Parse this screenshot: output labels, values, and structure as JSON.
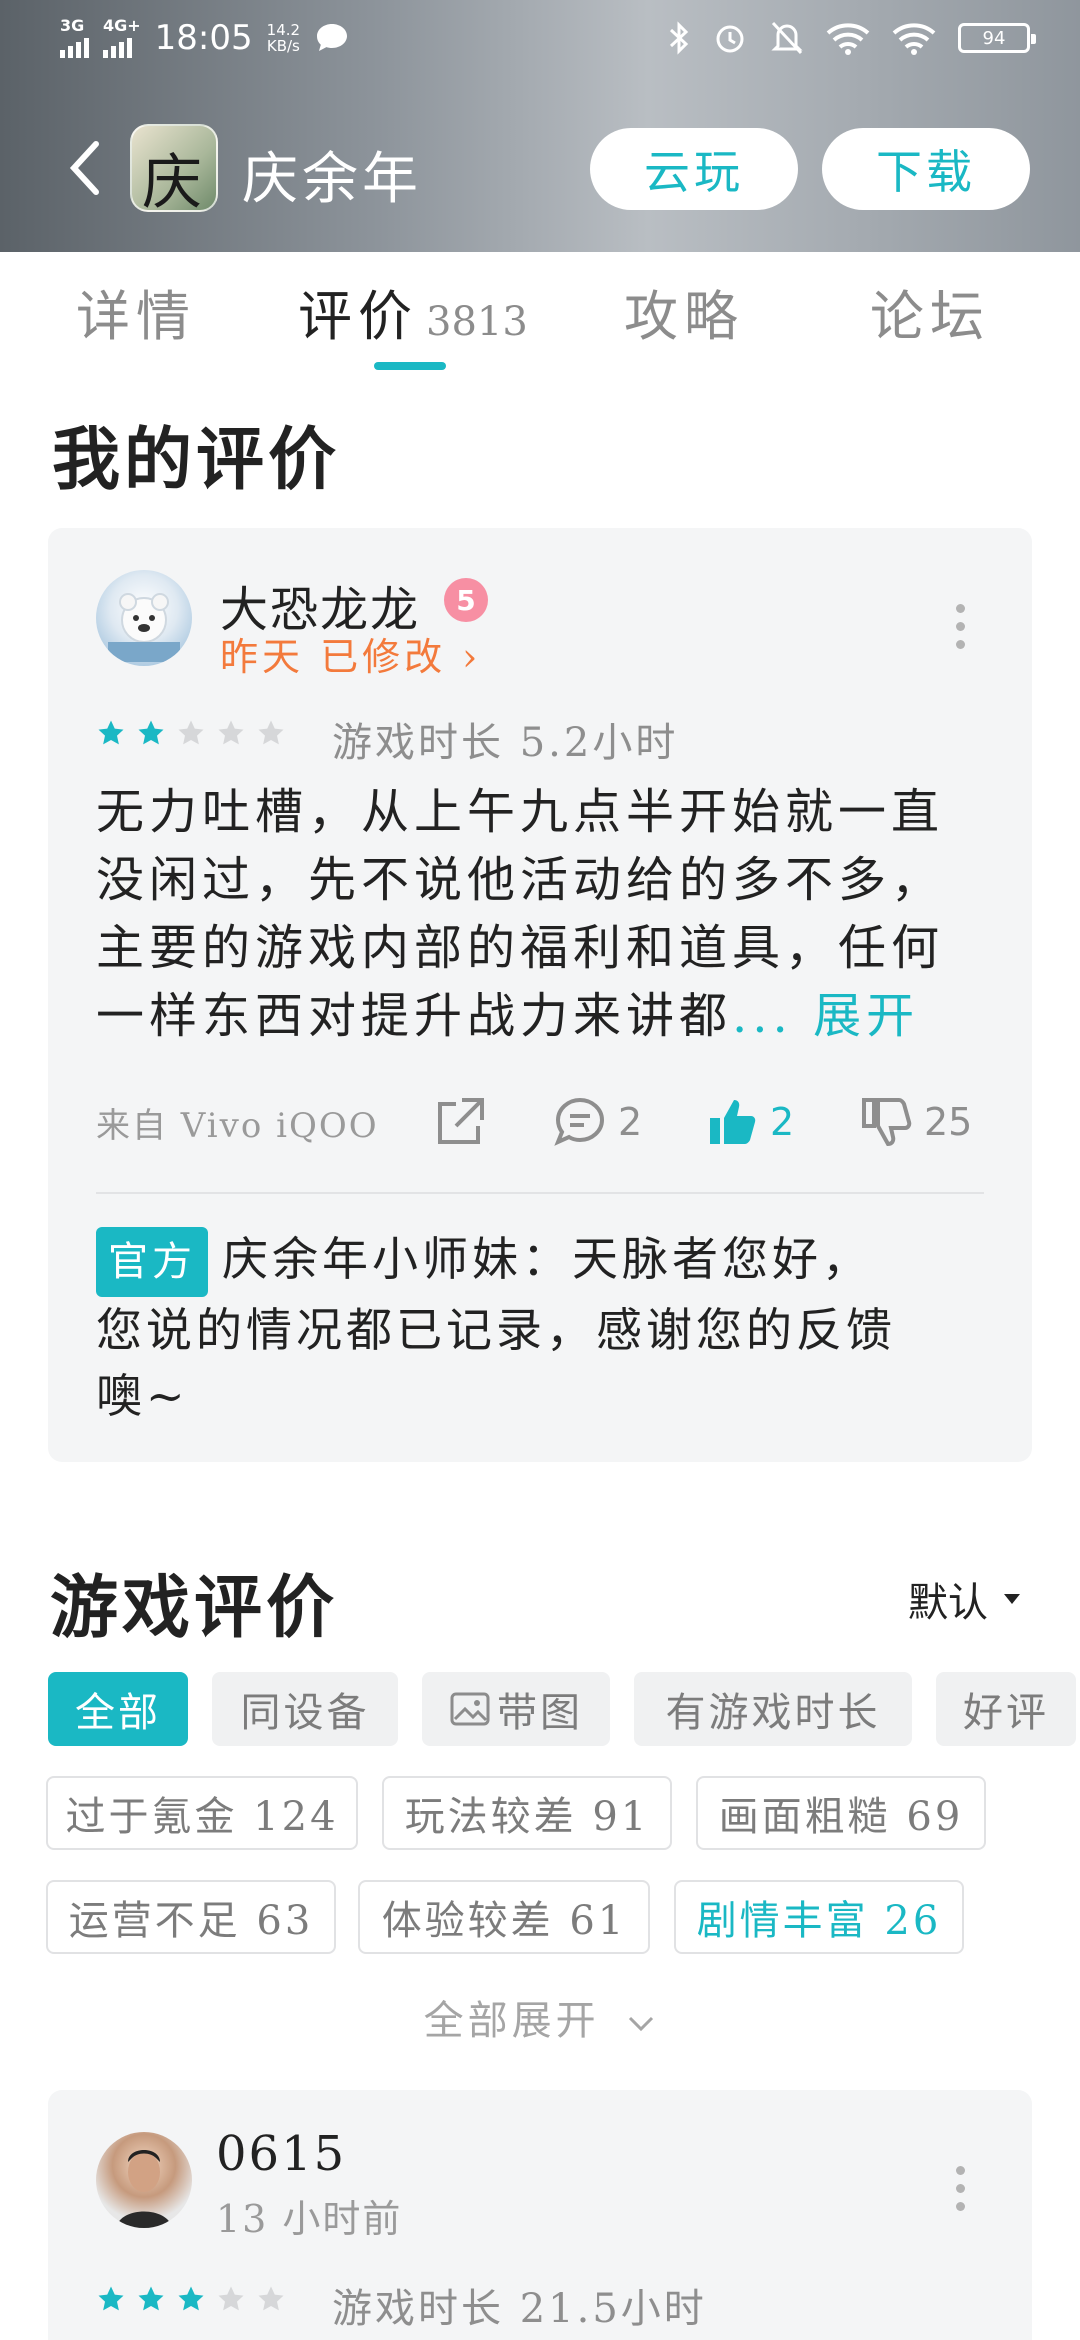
{
  "status_bar": {
    "network1": "3G",
    "network2": "4G+",
    "time": "18:05",
    "speed_value": "14.2",
    "speed_unit": "KB/s",
    "battery": "94"
  },
  "nav": {
    "app_title": "庆余年",
    "icon_glyph": "庆",
    "cloud_play_label": "云玩",
    "download_label": "下载"
  },
  "tabs": [
    {
      "label": "详情"
    },
    {
      "label": "评价",
      "count": "3813"
    },
    {
      "label": "攻略"
    },
    {
      "label": "论坛"
    }
  ],
  "my_review": {
    "section_title": "我的评价",
    "username": "大恐龙龙",
    "level": "5",
    "time_label": "昨天 已修改",
    "stars_filled": 2,
    "stars_total": 5,
    "playtime": "游戏时长 5.2小时",
    "text_lines": [
      "无力吐槽，从上午九点半开始就一直",
      "没闲过，先不说他活动给的多不多，",
      "主要的游戏内部的福利和道具，任何",
      "一样东西对提升战力来讲都"
    ],
    "ellipsis": "...",
    "expand_label": "展开",
    "device": "来自 Vivo iQOO",
    "comments": "2",
    "likes": "2",
    "dislikes": "25",
    "official_badge": "官方",
    "reply_lines": [
      "庆余年小师妹：天脉者您好，",
      "您说的情况都已记录，感谢您的反馈",
      "噢~"
    ]
  },
  "game_reviews": {
    "section_title": "游戏评价",
    "sort_label": "默认",
    "filter_row": [
      "全部",
      "同设备",
      "带图",
      "有游戏时长",
      "好评"
    ],
    "tag_rows": [
      [
        "过于氪金 124",
        "玩法较差 91",
        "画面粗糙 69"
      ],
      [
        "运营不足 63",
        "体验较差 61",
        "剧情丰富 26"
      ]
    ],
    "expand_all_label": "全部展开"
  },
  "second_review": {
    "username": "0615",
    "time_label": "13 小时前",
    "stars_filled": 3,
    "stars_total": 5,
    "playtime": "游戏时长 21.5小时"
  },
  "colors": {
    "accent": "#1ab8c4",
    "orange": "#f37a3c",
    "card_bg": "#f4f5f6"
  }
}
